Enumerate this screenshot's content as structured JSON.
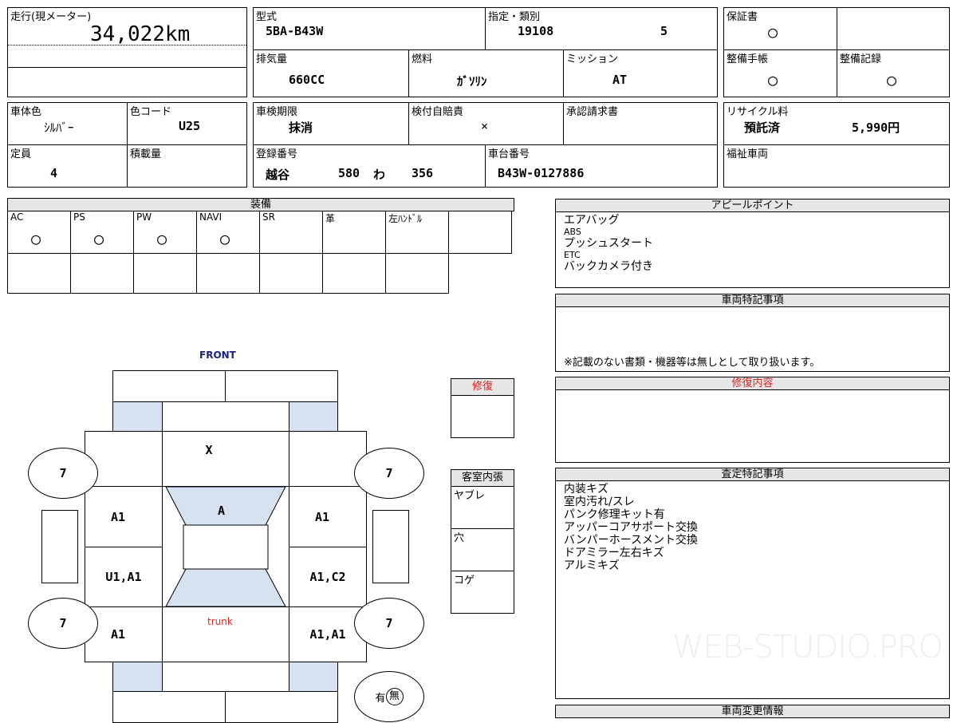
{
  "mileage": {
    "label": "走行(現メーター)",
    "value": "34,022km"
  },
  "model": {
    "label": "型式",
    "value": "5BA-B43W"
  },
  "designation": {
    "label": "指定・類別",
    "value1": "19108",
    "value2": "5"
  },
  "warranty": {
    "label": "保証書",
    "value": "○"
  },
  "displacement": {
    "label": "排気量",
    "value": "660CC"
  },
  "fuel": {
    "label": "燃料",
    "value": "ｶﾞｿﾘﾝ"
  },
  "transmission": {
    "label": "ミッション",
    "value": "AT"
  },
  "maintenance_book": {
    "label": "整備手帳",
    "value": "○"
  },
  "maintenance_record": {
    "label": "整備記録",
    "value": "○"
  },
  "color": {
    "label": "車体色",
    "value": "ｼﾙﾊﾞｰ"
  },
  "color_code": {
    "label": "色コード",
    "value": "U25"
  },
  "inspection": {
    "label": "車検期限",
    "value": "抹消"
  },
  "insurance": {
    "label": "検付自賠責",
    "value": "×"
  },
  "approval": {
    "label": "承認請求書"
  },
  "recycle": {
    "label": "リサイクル料",
    "status": "預託済",
    "amount": "5,990円"
  },
  "capacity": {
    "label": "定員",
    "value": "4"
  },
  "load": {
    "label": "積載量"
  },
  "registration": {
    "label": "登録番号",
    "area": "越谷",
    "class": "580",
    "kana": "わ",
    "number": "356"
  },
  "chassis": {
    "label": "車台番号",
    "value": "B43W-0127886"
  },
  "welfare": {
    "label": "福祉車両"
  },
  "equipment": {
    "title": "装備",
    "items": [
      {
        "label": "AC",
        "value": "○"
      },
      {
        "label": "PS",
        "value": "○"
      },
      {
        "label": "PW",
        "value": "○"
      },
      {
        "label": "NAVI",
        "value": "○"
      },
      {
        "label": "SR",
        "value": ""
      },
      {
        "label": "革",
        "value": ""
      },
      {
        "label": "左ﾊﾝﾄﾞﾙ",
        "value": ""
      },
      {
        "label": "",
        "value": ""
      }
    ]
  },
  "appeal": {
    "title": "アピールポイント",
    "lines": [
      "エアバッグ",
      "ABS",
      "プッシュスタート",
      "ETC",
      "バックカメラ付き"
    ]
  },
  "special_notes": {
    "title": "車両特記事項",
    "note": "※記載のない書類・機器等は無しとして取り扱います。"
  },
  "repair_content": {
    "title": "修復内容"
  },
  "assessment": {
    "title": "査定特記事項",
    "lines": [
      "内装キズ",
      "室内汚れ/スレ",
      "パンク修理キット有",
      "アッパーコアサポート交換",
      "バンパーホースメント交換",
      "ドアミラー左右キズ",
      "アルミキズ"
    ]
  },
  "changes": {
    "title": "車両変更情報"
  },
  "repair": {
    "title": "修復"
  },
  "interior": {
    "title": "客室内張",
    "items": [
      "ヤブレ",
      "穴",
      "コゲ"
    ]
  },
  "diagram": {
    "front": "FRONT",
    "trunk": "trunk",
    "roof_front": "X",
    "windshield": "A",
    "front_left": "A1",
    "front_right": "A1",
    "mid_left": "U1,A1",
    "mid_right": "A1,C2",
    "rear_left": "A1",
    "rear_right": "A1,A1",
    "tire_fl": "7",
    "tire_fr": "7",
    "tire_rl": "7",
    "tire_rr": "7",
    "spare_has": "有",
    "spare_none": "無"
  },
  "watermark": "WEB-STUDIO.PRO"
}
